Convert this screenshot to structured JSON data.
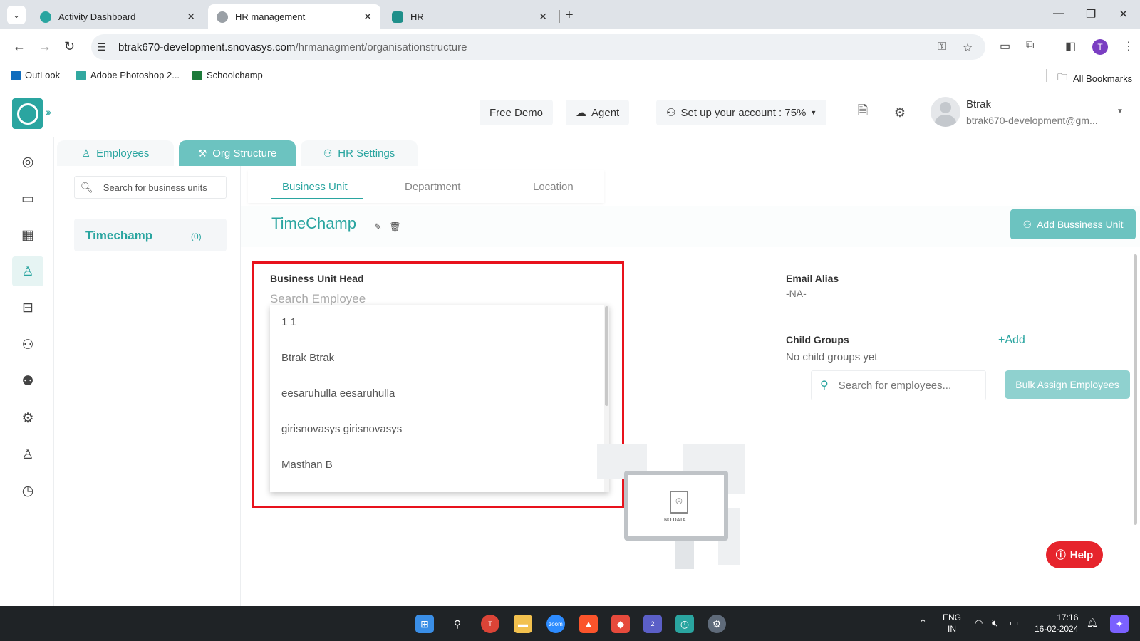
{
  "browser": {
    "tabs": [
      {
        "title": "Activity Dashboard"
      },
      {
        "title": "HR management"
      },
      {
        "title": "HR"
      }
    ],
    "url_domain": "btrak670-development.snovasys.com",
    "url_path": "/hrmanagment/organisationstructure",
    "bookmarks": [
      "OutLook",
      "Adobe Photoshop 2...",
      "Schoolchamp"
    ],
    "all_bookmarks": "All Bookmarks",
    "profile_initial": "T"
  },
  "header": {
    "free_demo": "Free Demo",
    "agent": "Agent",
    "setup": "Set up your account : 75%",
    "user_name": "Btrak",
    "user_email": "btrak670-development@gm..."
  },
  "top_tabs": [
    {
      "label": "Employees",
      "icon": "user-icon"
    },
    {
      "label": "Org Structure",
      "icon": "tools-icon"
    },
    {
      "label": "HR Settings",
      "icon": "user-settings-icon"
    }
  ],
  "left_panel": {
    "search_placeholder": "Search for business units",
    "unit_name": "Timechamp",
    "unit_count": "(0)"
  },
  "sub_tabs": [
    "Business Unit",
    "Department",
    "Location"
  ],
  "unit": {
    "title": "TimeChamp",
    "add_button": "Add Bussiness Unit",
    "head_label": "Business Unit Head",
    "head_placeholder": "Search Employee",
    "employees": [
      "1 1",
      "Btrak Btrak",
      "eesaruhulla eesaruhulla",
      "girisnovasys girisnovasys",
      "Masthan B"
    ],
    "email_alias_label": "Email Alias",
    "email_alias_value": "-NA-",
    "child_groups_label": "Child Groups",
    "add_link": "+Add",
    "no_child": "No child groups yet",
    "emp_search_placeholder": "Search for employees...",
    "bulk_assign": "Bulk Assign Employees",
    "no_data": "NO DATA"
  },
  "help": "Help",
  "taskbar": {
    "lang_top": "ENG",
    "lang_bottom": "IN",
    "time": "17:16",
    "date": "16-02-2024",
    "chrome_badge": "T",
    "teams_badge": "2"
  },
  "colors": {
    "accent": "#2aa5a0",
    "accent_light": "#6cc3c0",
    "highlight": "#e8121c",
    "help": "#e6242c"
  }
}
